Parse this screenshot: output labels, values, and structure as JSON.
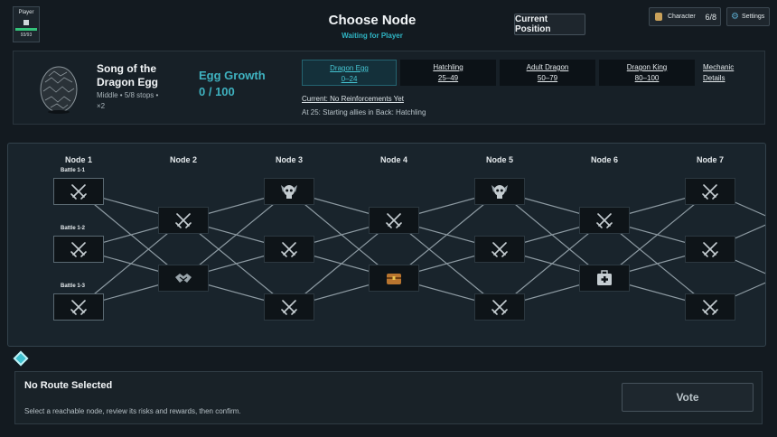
{
  "player": {
    "label": "Player",
    "hp": "93/93"
  },
  "header": {
    "title": "Choose Node",
    "subtitle": "Waiting for Player",
    "current_position_label": "Current Position",
    "character_label": "Character",
    "character_count": "6/8",
    "settings_label": "Settings"
  },
  "route_info": {
    "name": "Song of the Dragon Egg",
    "meta_line1": "Middle  •  5/8 stops  •",
    "meta_line2": "×2",
    "growth_label": "Egg Growth",
    "growth_value": "0 / 100",
    "stages": [
      {
        "name": "Dragon Egg",
        "range": "0–24",
        "active": true
      },
      {
        "name": "Hatchling",
        "range": "25–49",
        "active": false
      },
      {
        "name": "Adult Dragon",
        "range": "50–79",
        "active": false
      },
      {
        "name": "Dragon King",
        "range": "80–100",
        "active": false
      }
    ],
    "mechanic_details": "Mechanic Details",
    "current_text": "Current: No Reinforcements Yet",
    "at_text": "At 25: Starting allies in Back: Hatchling"
  },
  "map": {
    "columns": [
      "Node 1",
      "Node 2",
      "Node 3",
      "Node 4",
      "Node 5",
      "Node 6",
      "Node 7"
    ],
    "battle_labels": [
      "Battle 1-1",
      "Battle 1-2",
      "Battle 1-3"
    ],
    "nodes": [
      {
        "col": 0,
        "row": 0,
        "type": "swords-icon"
      },
      {
        "col": 0,
        "row": 2,
        "type": "swords-icon"
      },
      {
        "col": 0,
        "row": 4,
        "type": "swords-icon"
      },
      {
        "col": 1,
        "row": 1,
        "type": "swords-icon"
      },
      {
        "col": 1,
        "row": 3,
        "type": "handshake-icon"
      },
      {
        "col": 2,
        "row": 0,
        "type": "elite-skull-icon"
      },
      {
        "col": 2,
        "row": 2,
        "type": "swords-icon"
      },
      {
        "col": 2,
        "row": 4,
        "type": "swords-icon"
      },
      {
        "col": 3,
        "row": 1,
        "type": "swords-icon"
      },
      {
        "col": 3,
        "row": 3,
        "type": "treasure-chest-icon"
      },
      {
        "col": 4,
        "row": 0,
        "type": "elite-skull-icon"
      },
      {
        "col": 4,
        "row": 2,
        "type": "swords-icon"
      },
      {
        "col": 4,
        "row": 4,
        "type": "swords-icon"
      },
      {
        "col": 5,
        "row": 1,
        "type": "swords-icon"
      },
      {
        "col": 5,
        "row": 3,
        "type": "medkit-icon"
      },
      {
        "col": 6,
        "row": 0,
        "type": "swords-icon"
      },
      {
        "col": 6,
        "row": 2,
        "type": "swords-icon"
      },
      {
        "col": 6,
        "row": 4,
        "type": "swords-icon"
      }
    ]
  },
  "bottom": {
    "title": "No Route Selected",
    "description": "Select a reachable node, review its risks and rewards, then confirm.",
    "vote_label": "Vote"
  }
}
